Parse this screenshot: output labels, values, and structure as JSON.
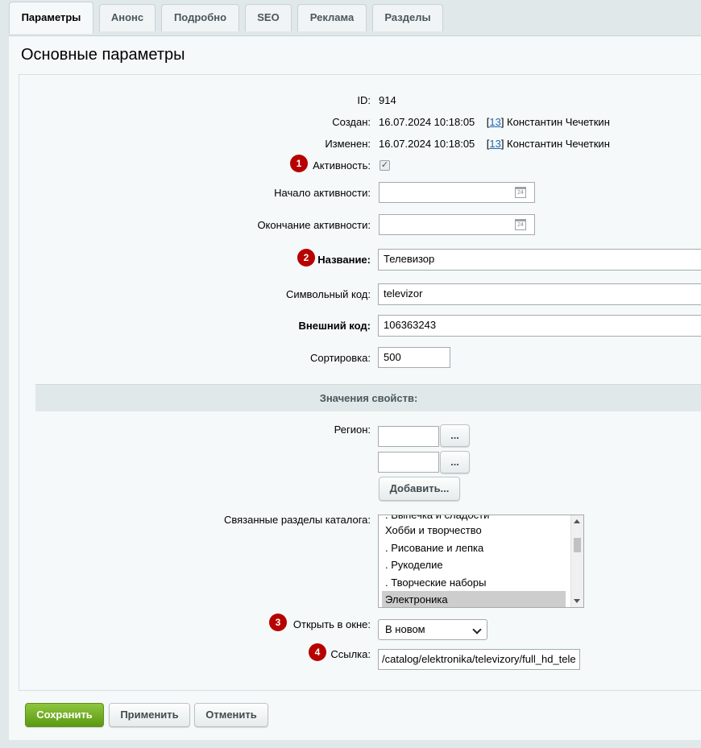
{
  "tabs": [
    {
      "label": "Параметры"
    },
    {
      "label": "Анонс"
    },
    {
      "label": "Подробно"
    },
    {
      "label": "SEO"
    },
    {
      "label": "Реклама"
    },
    {
      "label": "Разделы"
    }
  ],
  "page_title": "Основные параметры",
  "fields": {
    "id": {
      "label": "ID:",
      "value": "914"
    },
    "created": {
      "label": "Создан:",
      "date": "16.07.2024 10:18:05",
      "user_id": "13",
      "user_name": "Константин Чечеткин"
    },
    "modified": {
      "label": "Изменен:",
      "date": "16.07.2024 10:18:05",
      "user_id": "13",
      "user_name": "Константин Чечеткин"
    },
    "active": {
      "label": "Активность:",
      "checked": true
    },
    "active_from": {
      "label": "Начало активности:",
      "value": ""
    },
    "active_to": {
      "label": "Окончание активности:",
      "value": ""
    },
    "name": {
      "label": "Название:",
      "value": "Телевизор"
    },
    "code": {
      "label": "Символьный код:",
      "value": "televizor"
    },
    "xml_id": {
      "label": "Внешний код:",
      "value": "106363243"
    },
    "sort": {
      "label": "Сортировка:",
      "value": "500"
    }
  },
  "properties": {
    "heading": "Значения свойств:",
    "region": {
      "label": "Регион:",
      "values": [
        "",
        ""
      ],
      "pick_label": "...",
      "add_label": "Добавить..."
    },
    "sections": {
      "label": "Связанные разделы каталога:",
      "items": [
        {
          "text": ". Выпечка и сладости"
        },
        {
          "text": "Хобби и творчество"
        },
        {
          "text": ". Рисование и лепка"
        },
        {
          "text": ". Рукоделие"
        },
        {
          "text": ". Творческие наборы"
        },
        {
          "text": "Электроника",
          "selected": true
        }
      ]
    },
    "open_in": {
      "label": "Открыть в окне:",
      "value": "В новом"
    },
    "link": {
      "label": "Ссылка:",
      "value": "/catalog/elektronika/televizory/full_hd_tele"
    }
  },
  "markers": [
    "1",
    "2",
    "3",
    "4"
  ],
  "cal_icon_text": "24",
  "buttons": {
    "save": "Сохранить",
    "apply": "Применить",
    "cancel": "Отменить"
  },
  "colors": {
    "save_button": "#6aa51e",
    "marker": "#b80000",
    "link": "#2067b0"
  }
}
